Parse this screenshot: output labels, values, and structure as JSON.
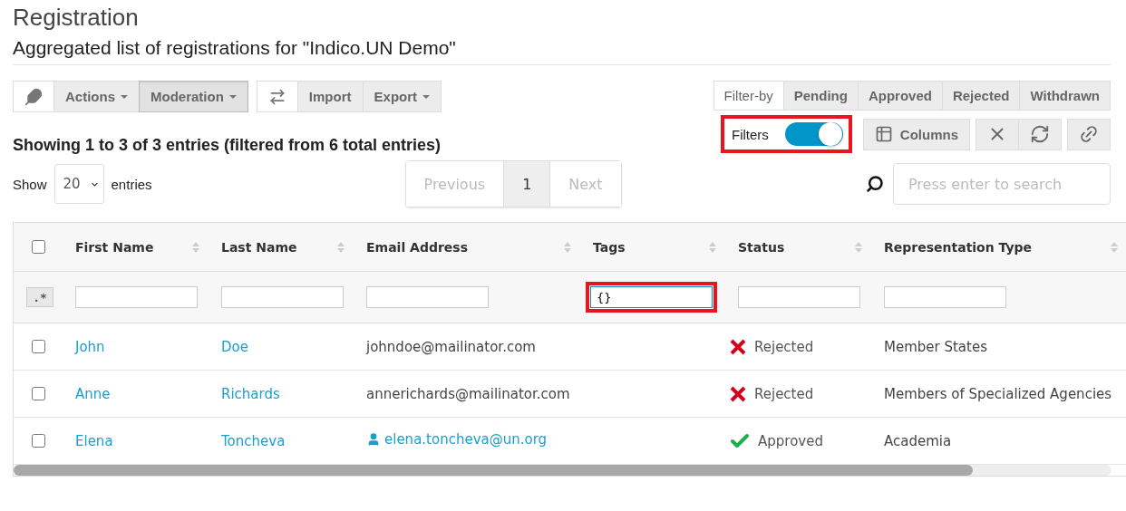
{
  "title": "Registration",
  "subtitle": "Aggregated list of registrations for \"Indico.UN Demo\"",
  "toolbar": {
    "groups": [
      {
        "kind": "feather",
        "buttons": [
          {
            "label": "Actions",
            "caret": true,
            "pressed": false
          },
          {
            "label": "Moderation",
            "caret": true,
            "pressed": true
          }
        ]
      },
      {
        "kind": "swap",
        "buttons": [
          {
            "label": "Import",
            "caret": false,
            "pressed": false
          },
          {
            "label": "Export",
            "caret": true,
            "pressed": false
          }
        ]
      }
    ],
    "filter_by": {
      "label": "Filter-by",
      "options": [
        {
          "label": "Pending",
          "selected": false
        },
        {
          "label": "Approved",
          "selected": false
        },
        {
          "label": "Rejected",
          "selected": false
        },
        {
          "label": "Withdrawn",
          "selected": false
        }
      ]
    }
  },
  "summary": "Showing 1 to 3 of 3 entries (filtered from 6 total entries)",
  "filters_toggle": {
    "label": "Filters",
    "on": true,
    "highlighted": true
  },
  "columns_button": "Columns",
  "length": {
    "show": "Show",
    "value": "20",
    "entries": "entries"
  },
  "pagination": [
    {
      "label": "Previous",
      "disabled": true,
      "selected": false
    },
    {
      "label": "1",
      "disabled": false,
      "selected": true
    },
    {
      "label": "Next",
      "disabled": true,
      "selected": false
    }
  ],
  "search": {
    "placeholder": "Press enter to search"
  },
  "table": {
    "select_all_checked": false,
    "regex_button": ".*",
    "columns": [
      {
        "label": "First Name",
        "highlighted": false
      },
      {
        "label": "Last Name",
        "highlighted": false
      },
      {
        "label": "Email Address",
        "highlighted": false
      },
      {
        "label": "Tags",
        "filter": "{}",
        "highlighted": true
      },
      {
        "label": "Status",
        "highlighted": false
      },
      {
        "label": "Representation Type",
        "highlighted": false
      }
    ],
    "rows": [
      {
        "checked": false,
        "first_name": "John",
        "last_name": "Doe",
        "email": "johndoe@mailinator.com",
        "linked_user": false,
        "status": {
          "kind": "rejected",
          "label": "Rejected"
        },
        "representation": "Member States"
      },
      {
        "checked": false,
        "first_name": "Anne",
        "last_name": "Richards",
        "email": "annerichards@mailinator.com",
        "linked_user": false,
        "status": {
          "kind": "rejected",
          "label": "Rejected"
        },
        "representation": "Members of Specialized Agencies"
      },
      {
        "checked": false,
        "first_name": "Elena",
        "last_name": "Toncheva",
        "email": "elena.toncheva@un.org",
        "linked_user": true,
        "status": {
          "kind": "approved",
          "label": "Approved"
        },
        "representation": "Academia"
      }
    ]
  }
}
